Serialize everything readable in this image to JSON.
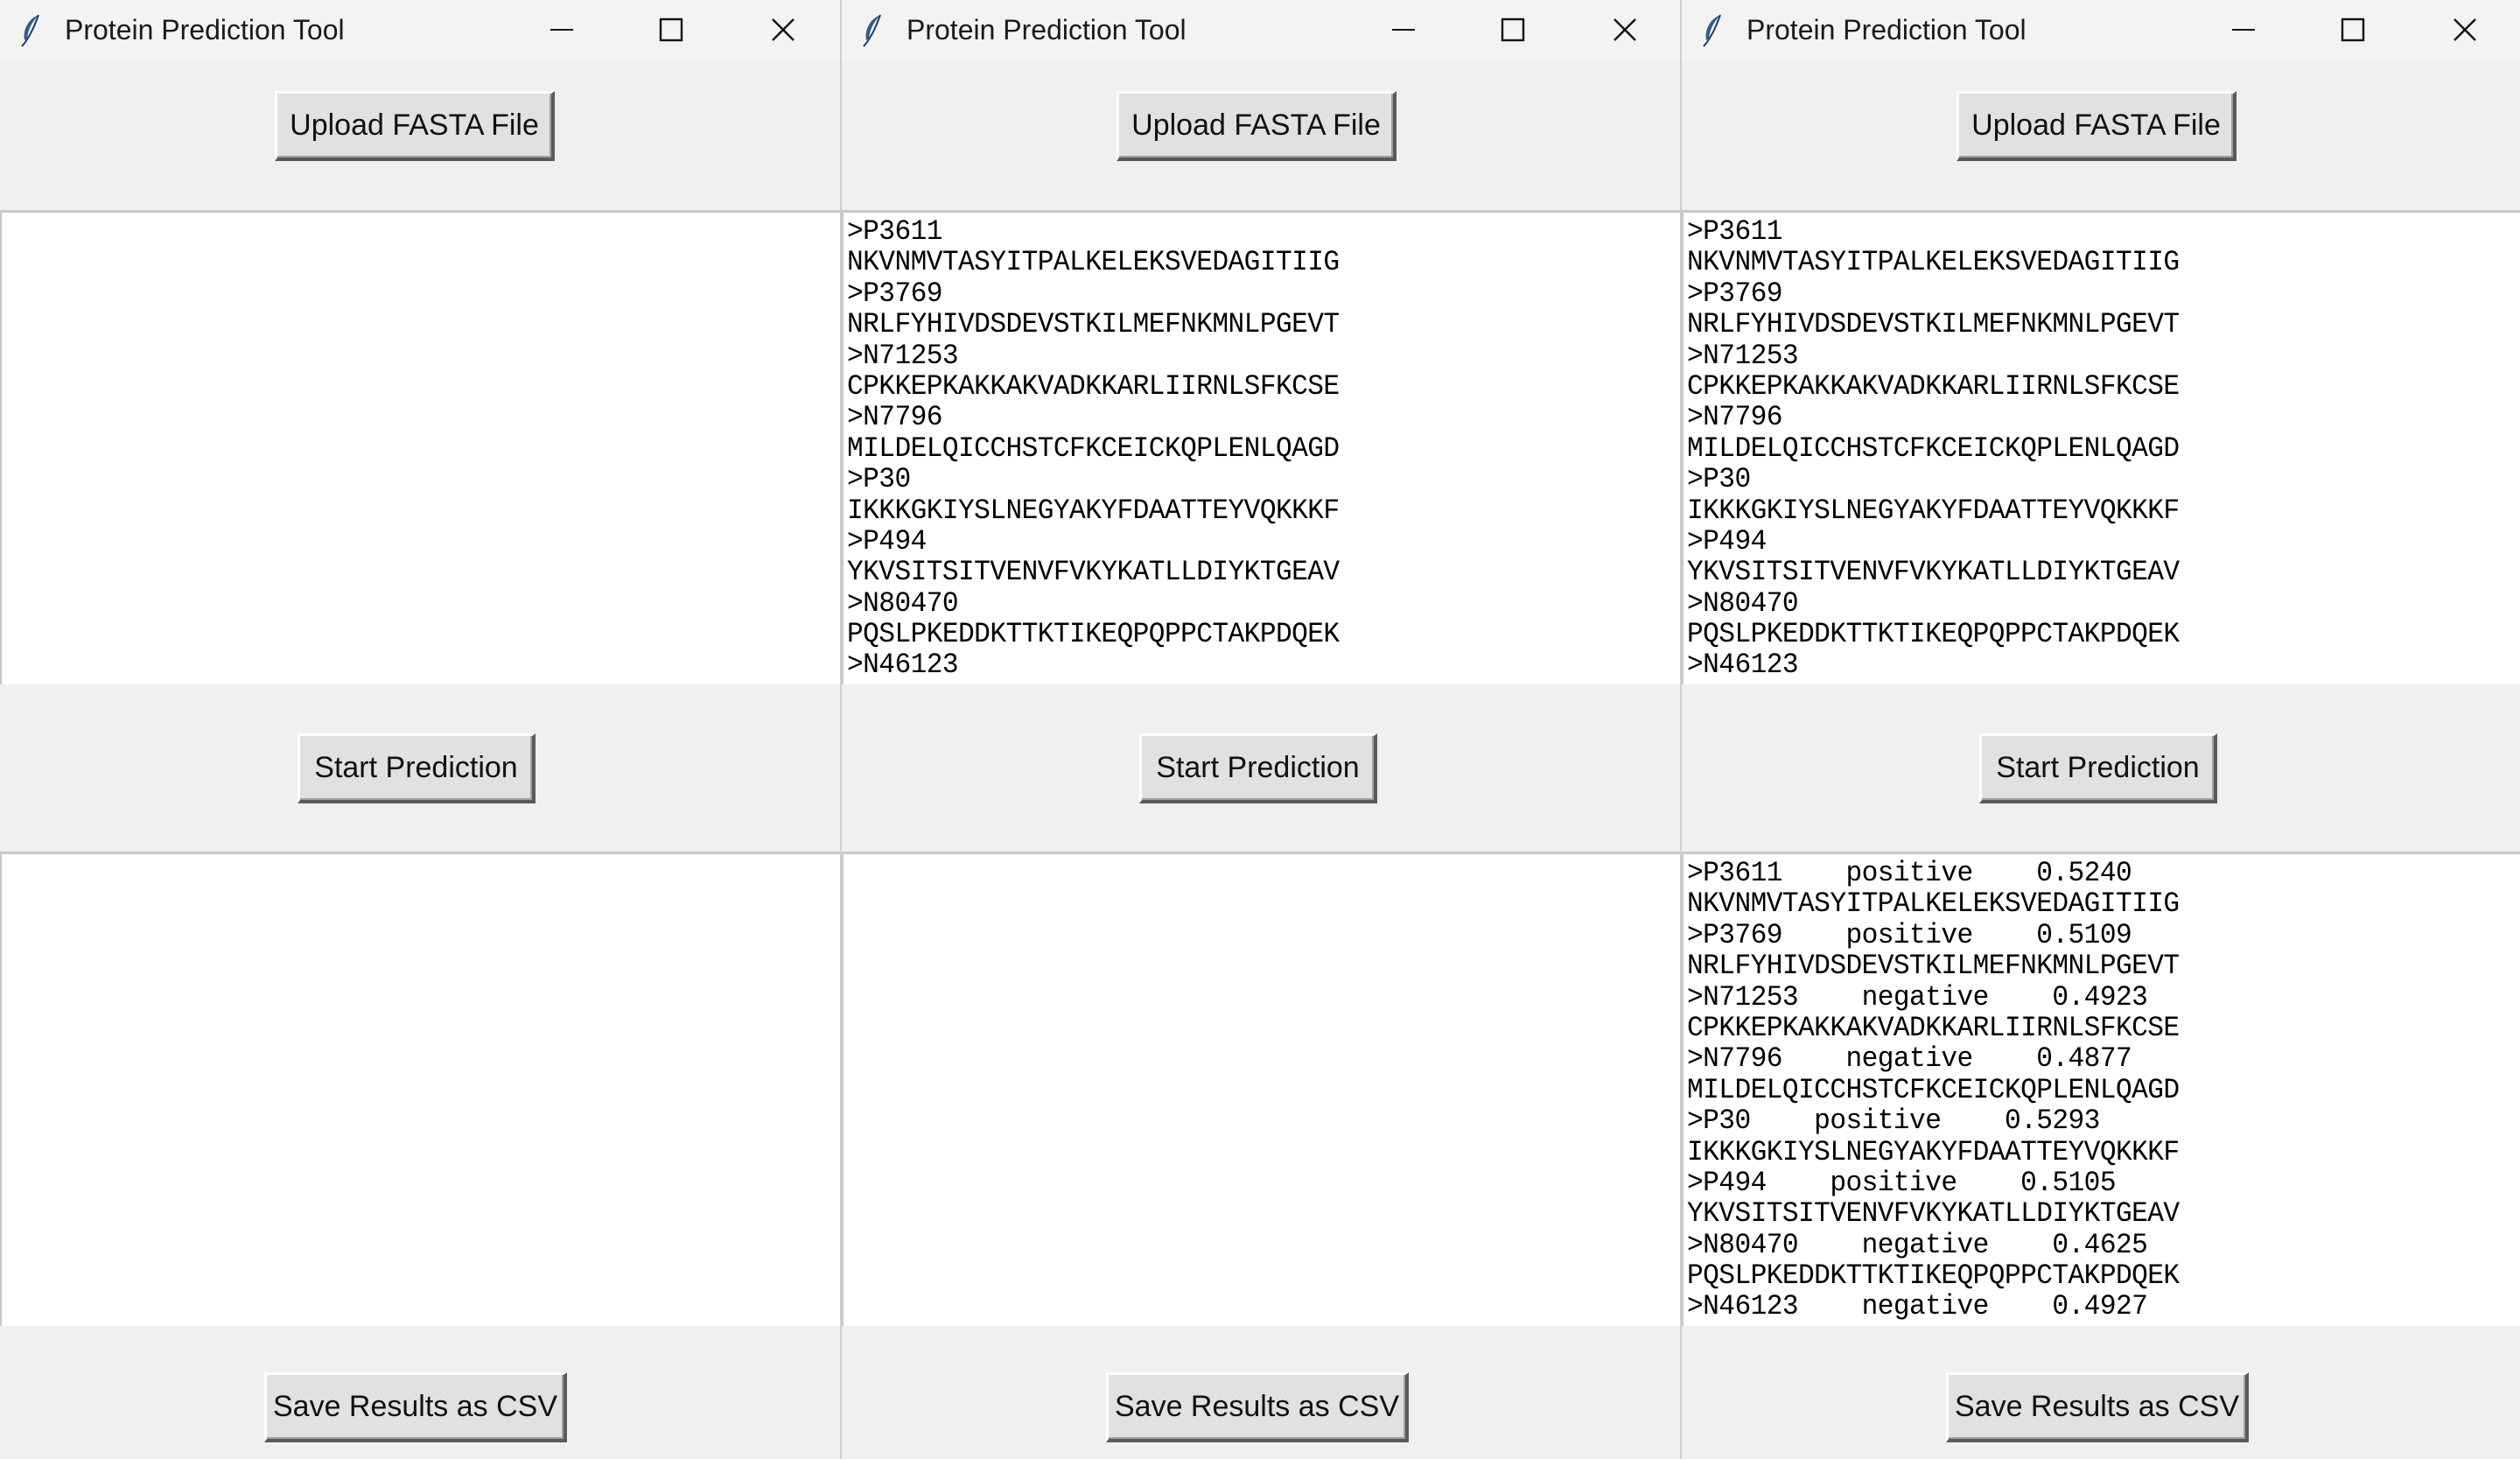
{
  "windows": [
    {
      "title": "Protein Prediction Tool",
      "buttons": {
        "upload_label": "Upload FASTA File",
        "start_label": "Start Prediction",
        "save_label": "Save Results as CSV"
      },
      "input_lines": [],
      "output_lines": []
    },
    {
      "title": "Protein Prediction Tool",
      "buttons": {
        "upload_label": "Upload FASTA File",
        "start_label": "Start Prediction",
        "save_label": "Save Results as CSV"
      },
      "input_lines": [
        ">P3611",
        "NKVNMVTASYITPALKELEKSVEDAGITIIG",
        ">P3769",
        "NRLFYHIVDSDEVSTKILMEFNKMNLPGEVT",
        ">N71253",
        "CPKKEPKAKKAKVADKKARLIIRNLSFKCSE",
        ">N7796",
        "MILDELQICCHSTCFKCEICKQPLENLQAGD",
        ">P30",
        "IKKKGKIYSLNEGYAKYFDAATTEYVQKKKF",
        ">P494",
        "YKVSITSITVENVFVKYKATLLDIYKTGEAV",
        ">N80470",
        "PQSLPKEDDKTTKTIKEQPQPPCTAKPDQEK",
        ">N46123"
      ],
      "output_lines": []
    },
    {
      "title": "Protein Prediction Tool",
      "buttons": {
        "upload_label": "Upload FASTA File",
        "start_label": "Start Prediction",
        "save_label": "Save Results as CSV"
      },
      "input_lines": [
        ">P3611",
        "NKVNMVTASYITPALKELEKSVEDAGITIIG",
        ">P3769",
        "NRLFYHIVDSDEVSTKILMEFNKMNLPGEVT",
        ">N71253",
        "CPKKEPKAKKAKVADKKARLIIRNLSFKCSE",
        ">N7796",
        "MILDELQICCHSTCFKCEICKQPLENLQAGD",
        ">P30",
        "IKKKGKIYSLNEGYAKYFDAATTEYVQKKKF",
        ">P494",
        "YKVSITSITVENVFVKYKATLLDIYKTGEAV",
        ">N80470",
        "PQSLPKEDDKTTKTIKEQPQPPCTAKPDQEK",
        ">N46123"
      ],
      "output_lines": [
        ">P3611\tpositive\t0.5240",
        "NKVNMVTASYITPALKELEKSVEDAGITIIG",
        ">P3769\tpositive\t0.5109",
        "NRLFYHIVDSDEVSTKILMEFNKMNLPGEVT",
        ">N71253\tnegative\t0.4923",
        "CPKKEPKAKKAKVADKKARLIIRNLSFKCSE",
        ">N7796\tnegative\t0.4877",
        "MILDELQICCHSTCFKCEICKQPLENLQAGD",
        ">P30\tpositive\t0.5293",
        "IKKKGKIYSLNEGYAKYFDAATTEYVQKKKF",
        ">P494\tpositive\t0.5105",
        "YKVSITSITVENVFVKYKATLLDIYKTGEAV",
        ">N80470\tnegative\t0.4625",
        "PQSLPKEDDKTTKTIKEQPQPPCTAKPDQEK",
        ">N46123\tnegative\t0.4927"
      ]
    }
  ]
}
